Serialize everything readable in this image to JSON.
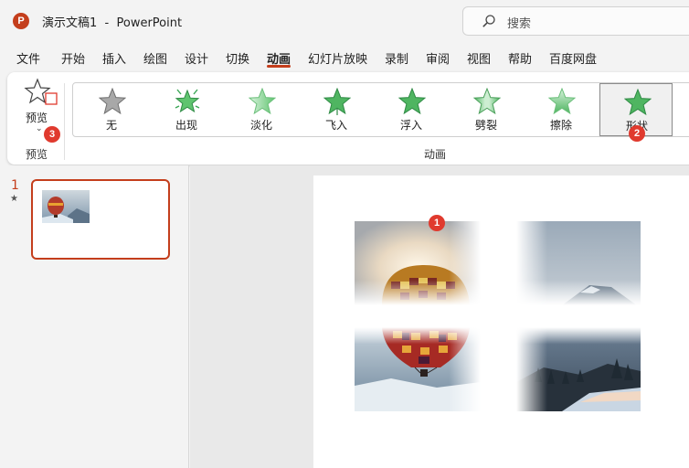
{
  "window": {
    "app_icon_letter": "P",
    "title": "演示文稿1  -  PowerPoint"
  },
  "search": {
    "placeholder": "搜索"
  },
  "menu": {
    "tabs": [
      "文件",
      "开始",
      "插入",
      "绘图",
      "设计",
      "切换",
      "动画",
      "幻灯片放映",
      "录制",
      "审阅",
      "视图",
      "帮助",
      "百度网盘"
    ],
    "active": "动画"
  },
  "ribbon": {
    "preview_label": "预览",
    "preview_group_label": "预览",
    "animation_group_label": "动画",
    "animations": [
      {
        "label": "无",
        "style": "gray"
      },
      {
        "label": "出现",
        "style": "burst"
      },
      {
        "label": "淡化",
        "style": "faded"
      },
      {
        "label": "飞入",
        "style": "fly"
      },
      {
        "label": "浮入",
        "style": "green"
      },
      {
        "label": "劈裂",
        "style": "split"
      },
      {
        "label": "擦除",
        "style": "wipe"
      },
      {
        "label": "形状",
        "style": "green"
      }
    ],
    "selected_animation": "形状"
  },
  "badges": {
    "picture": "1",
    "shape_animation": "2",
    "preview": "3"
  },
  "slides": {
    "current_number": "1",
    "animation_marker": "★"
  },
  "colors": {
    "accent": "#c43e1c",
    "badge": "#e03a2e",
    "star_green": "#3aa655"
  }
}
